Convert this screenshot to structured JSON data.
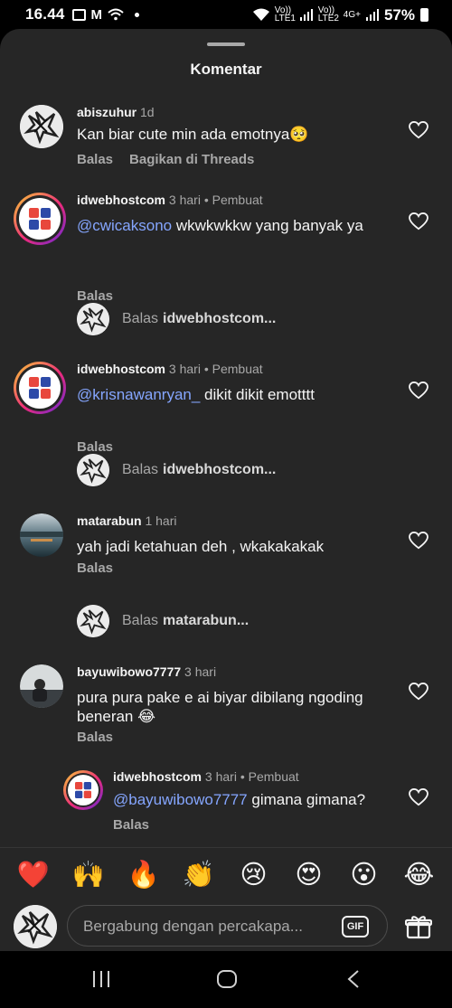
{
  "status_bar": {
    "time": "16.44",
    "battery": "57%",
    "sim1": "Vo)) LTE1",
    "sim2": "Vo)) LTE2",
    "net": "4G+"
  },
  "sheet": {
    "title": "Komentar"
  },
  "comments": [
    {
      "user": "abiszuhur",
      "time": "1d",
      "tag": "",
      "mention": "",
      "text": "Kan biar cute min ada emotnya🥺",
      "actions": [
        "Balas",
        "Bagikan di Threads"
      ]
    },
    {
      "user": "idwebhostcom",
      "time": "3 hari",
      "tag": "• Pembuat",
      "mention": "@cwicaksono",
      "text": " wkwkwkkw yang banyak ya",
      "actions": [
        "Balas"
      ]
    },
    {
      "user": "idwebhostcom",
      "time": "3 hari",
      "tag": "• Pembuat",
      "mention": "@krisnawanryan_",
      "text": " dikit dikit emotttt",
      "actions": [
        "Balas"
      ]
    },
    {
      "user": "matarabun",
      "time": "1 hari",
      "tag": "",
      "mention": "",
      "text": "yah jadi ketahuan deh , wkakakakak",
      "actions": [
        "Balas"
      ]
    },
    {
      "user": "bayuwibowo7777",
      "time": "3 hari",
      "tag": "",
      "mention": "",
      "text": "pura pura pake e ai biyar dibilang ngoding beneran 😂",
      "actions": [
        "Balas"
      ]
    },
    {
      "user": "idwebhostcom",
      "time": "3 hari",
      "tag": "• Pembuat",
      "mention": "@bayuwibowo7777",
      "text": " gimana gimana?",
      "actions": [
        "Balas"
      ]
    }
  ],
  "reply_links": [
    {
      "prefix": "Balas",
      "target": "idwebhostcom..."
    },
    {
      "prefix": "Balas",
      "target": "idwebhostcom..."
    },
    {
      "prefix": "Balas",
      "target": "matarabun..."
    }
  ],
  "quick_emojis": [
    "❤️",
    "🙌",
    "🔥",
    "👏",
    "😢",
    "😍",
    "😮",
    "😂"
  ],
  "composer": {
    "placeholder": "Bergabung dengan percakapa...",
    "gif_label": "GIF"
  },
  "colors": {
    "sheet_bg": "#262626",
    "mention": "#85a6ff",
    "secondary_text": "#a8a8a8"
  }
}
